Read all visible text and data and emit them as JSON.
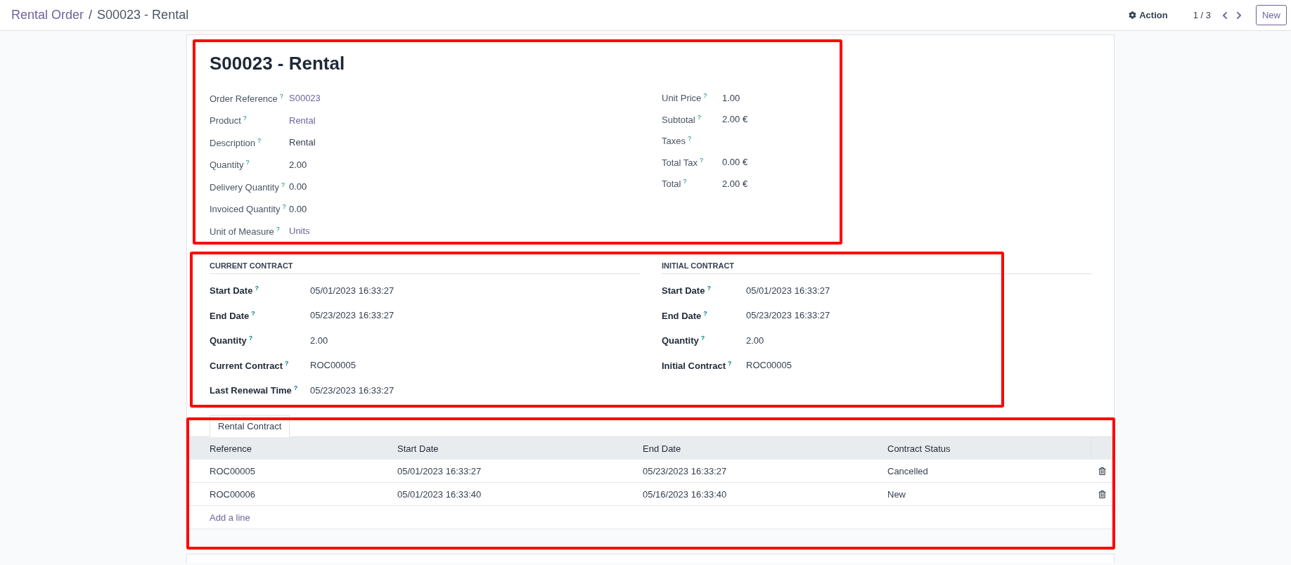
{
  "breadcrumb": {
    "parent": "Rental Order",
    "separator": "/",
    "current": "S00023 - Rental"
  },
  "control_panel": {
    "action": "Action",
    "pager": "1 / 3",
    "new_button": "New"
  },
  "title": "S00023 - Rental",
  "left_fields": [
    {
      "label": "Order Reference",
      "help": "?",
      "value": "S00023",
      "link": true
    },
    {
      "label": "Product",
      "help": "?",
      "value": "Rental",
      "link": true
    },
    {
      "label": "Description",
      "help": "?",
      "value": "Rental",
      "link": false
    },
    {
      "label": "Quantity",
      "help": "?",
      "value": "2.00",
      "link": false
    },
    {
      "label": "Delivery Quantity",
      "help": "?",
      "value": "0.00",
      "link": false
    },
    {
      "label": "Invoiced Quantity",
      "help": "?",
      "value": "0.00",
      "link": false
    },
    {
      "label": "Unit of Measure",
      "help": "?",
      "value": "Units",
      "link": true
    }
  ],
  "right_fields": [
    {
      "label": "Unit Price",
      "help": "?",
      "value": "1.00"
    },
    {
      "label": "Subtotal",
      "help": "?",
      "value": "2.00 €"
    },
    {
      "label": "Taxes",
      "help": "?"
    },
    {
      "label": "Total Tax",
      "help": "?",
      "value": "0.00 €"
    },
    {
      "label": "Total",
      "help": "?",
      "value": "2.00 €"
    }
  ],
  "contract_groups": [
    {
      "heading": "CURRENT CONTRACT",
      "fields": [
        {
          "label": "Start Date",
          "help": "?",
          "value": "05/01/2023 16:33:27"
        },
        {
          "label": "End Date",
          "help": "?",
          "value": "05/23/2023 16:33:27"
        },
        {
          "label": "Quantity",
          "help": "?",
          "value": "2.00"
        },
        {
          "label": "Current Contract",
          "help": "?",
          "value": "ROC00005"
        },
        {
          "label": "Last Renewal Time",
          "help": "?",
          "value": "05/23/2023 16:33:27"
        }
      ]
    },
    {
      "heading": "INITIAL CONTRACT",
      "fields": [
        {
          "label": "Start Date",
          "help": "?",
          "value": "05/01/2023 16:33:27"
        },
        {
          "label": "End Date",
          "help": "?",
          "value": "05/23/2023 16:33:27"
        },
        {
          "label": "Quantity",
          "help": "?",
          "value": "2.00"
        },
        {
          "label": "Initial Contract",
          "help": "?",
          "value": "ROC00005"
        }
      ]
    }
  ],
  "tabs": [
    {
      "label": "Rental Contract",
      "selected": true
    }
  ],
  "table": {
    "columns": [
      "Reference",
      "Start Date",
      "End Date",
      "Contract Status"
    ],
    "rows": [
      [
        "ROC00005",
        "05/01/2023 16:33:27",
        "05/23/2023 16:33:27",
        "Cancelled"
      ],
      [
        "ROC00006",
        "05/01/2023 16:33:40",
        "05/16/2023 16:33:40",
        "New"
      ]
    ],
    "add_line": "Add a line"
  }
}
